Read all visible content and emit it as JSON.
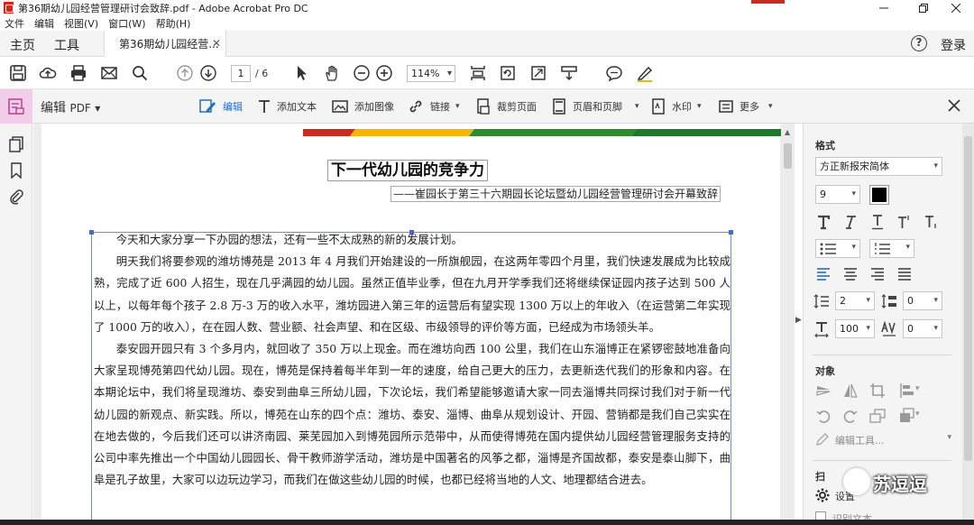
{
  "window": {
    "title": "第36期幼儿园经营管理研讨会致辞.pdf - Adobe Acrobat Pro DC"
  },
  "menu": [
    "文件",
    "编辑",
    "视图(V)",
    "窗口(W)",
    "帮助(H)"
  ],
  "tabs": {
    "home": "主页",
    "tools": "工具",
    "document": "第36期幼儿园经营...",
    "login": "登录"
  },
  "toolbar": {
    "page_current": "1",
    "page_total": "/ 6",
    "zoom": "114%"
  },
  "edit_toolbar": {
    "mode": "编辑",
    "mode_suffix": "PDF",
    "items": {
      "edit": "编辑",
      "add_text": "添加文本",
      "add_image": "添加图像",
      "link": "链接",
      "crop": "裁剪页面",
      "header_footer": "页眉和页脚",
      "watermark": "水印",
      "more": "更多"
    }
  },
  "document": {
    "title": "下一代幼儿园的竞争力",
    "subtitle": "——崔园长于第三十六期园长论坛暨幼儿园经营管理研讨会开幕致辞",
    "paragraphs": [
      "今天和大家分享一下办园的想法，还有一些不太成熟的新的发展计划。",
      "明天我们将要参观的潍坊博苑是 2013 年 4 月我们开始建设的一所旗舰园，在这两年零四个月里，我们快速发展成为比较成熟，完成了近 600 人招生，现在几乎满园的幼儿园。虽然正值毕业季，但在九月开学季我们还将继续保证园内孩子达到 500 人以上，以每年每个孩子 2.8 万-3 万的收入水平，潍坊园进入第三年的运营后有望实现 1300 万以上的年收入（在运营第二年实现了 1000 万的收入），在在园人数、营业额、社会声望、和在区级、市级领导的评价等方面，已经成为市场领头羊。",
      "泰安园开园只有 3 个多月内，就回收了 350 万以上现金。而在潍坊向西 100 公里，我们在山东淄博正在紧锣密鼓地准备向大家呈现博苑第四代幼儿园。现在，博苑是保持着每半年到一年的速度，给自己更大的压力，去更新迭代我们的形象和内容。在本期论坛中，我们将呈现潍坊、泰安到曲阜三所幼儿园，下次论坛，我们希望能够邀请大家一同去淄博共同探讨我们对于新一代幼儿园的新观点、新实践。所以，博苑在山东的四个点：潍坊、泰安、淄博、曲阜从规划设计、开园、营销都是我们自己实实在在地去做的，今后我们还可以讲济南园、莱芜园加入到博苑园所示范带中，从而使得博苑在国内提供幼儿园经营管理服务支持的公司中率先推出一个中国幼儿园园长、骨干教师游学活动，潍坊是中国著名的风筝之都，淄博是齐国故都，泰安是泰山脚下，曲阜是孔子故里，大家可以边玩边学习，而我们在做这些幼儿园的时候，也都已经将当地的人文、地理都结合进去。"
    ]
  },
  "right_panel": {
    "format_header": "格式",
    "font": "方正新报宋简体",
    "font_size": "9",
    "line_spacing": "2",
    "paragraph_spacing": "0",
    "horizontal_scale": "100",
    "char_spacing": "0",
    "object_header": "对象",
    "edit_tools": "编辑工具...",
    "settings": "设置",
    "header_partial": "扫",
    "footer_partial": "识别文本"
  },
  "watermark_text": "苏逗逗",
  "colors": {
    "pink_tab": "#f1cdea",
    "accent_blue": "#1f6fc0",
    "bar_red": "#cc2a1d",
    "bar_yellow": "#f2b705",
    "bar_green": "#2e8b2e"
  }
}
